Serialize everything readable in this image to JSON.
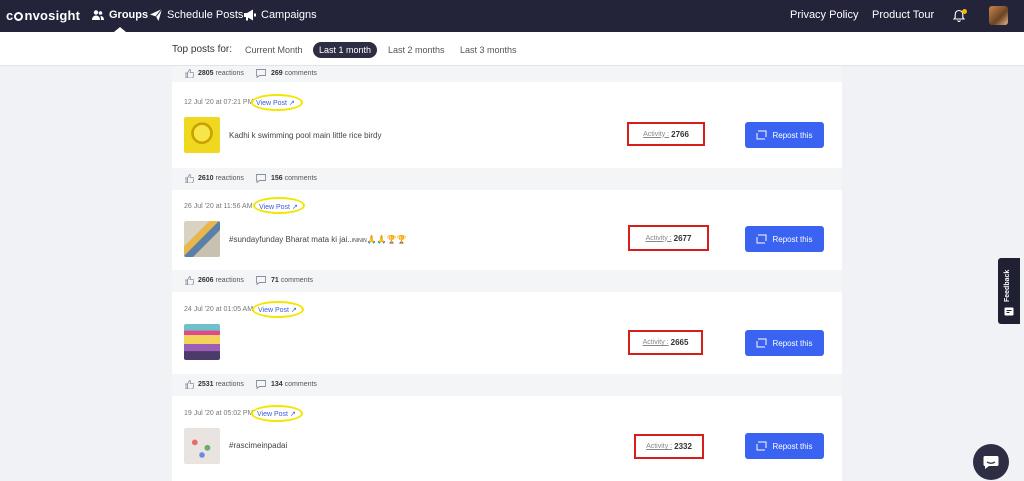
{
  "app": {
    "logo_text_pre": "c",
    "logo_text_post": "nvosight"
  },
  "nav": {
    "items": [
      {
        "label": "Groups",
        "icon": "users-icon",
        "active": true
      },
      {
        "label": "Schedule Posts",
        "icon": "paper-plane-icon",
        "active": false
      },
      {
        "label": "Campaigns",
        "icon": "megaphone-icon",
        "active": false
      }
    ],
    "privacy_policy": "Privacy Policy",
    "product_tour": "Product Tour",
    "notification_dot_color": "#f5b800"
  },
  "filters": {
    "label": "Top posts for:",
    "options": [
      "Current Month",
      "Last 1 month",
      "Last 2 months",
      "Last 3 months"
    ],
    "selected": "Last 1 month"
  },
  "top_stats": {
    "reactions": "2805",
    "reactions_label": "reactions",
    "comments": "269",
    "comments_label": "comments"
  },
  "posts": [
    {
      "date": "12 Jul '20 at 07:21 PM",
      "view_post": "View Post",
      "caption": "Kadhi k swimming pool main little rice birdy",
      "activity_label": "Activity :",
      "activity_value": "2766",
      "repost_label": "Repost this",
      "reactions": "2610",
      "reactions_label": "reactions",
      "comments": "156",
      "comments_label": "comments"
    },
    {
      "date": "26 Jul '20 at 11:56 AM",
      "view_post": "View Post",
      "caption": "#sundayfunday Bharat mata ki jai..",
      "caption_small": "INININ",
      "caption_emoji": "🙏🙏🏆🏆",
      "activity_label": "Activity :",
      "activity_value": "2677",
      "repost_label": "Repost this",
      "reactions": "2606",
      "reactions_label": "reactions",
      "comments": "71",
      "comments_label": "comments"
    },
    {
      "date": "24 Jul '20 at 01:05 AM",
      "view_post": "View Post",
      "caption": "",
      "activity_label": "Activity :",
      "activity_value": "2665",
      "repost_label": "Repost this",
      "reactions": "2531",
      "reactions_label": "reactions",
      "comments": "134",
      "comments_label": "comments"
    },
    {
      "date": "19 Jul '20 at 05:02 PM",
      "view_post": "View Post",
      "caption": "#rascimeinpadai",
      "activity_label": "Activity :",
      "activity_value": "2332",
      "repost_label": "Repost this"
    }
  ],
  "feedback": {
    "label": "Feedback"
  },
  "colors": {
    "nav_bg": "#23233a",
    "accent_blue": "#3a63f2",
    "highlight_red": "#d91c1c",
    "highlight_yellow": "#f2e600"
  }
}
